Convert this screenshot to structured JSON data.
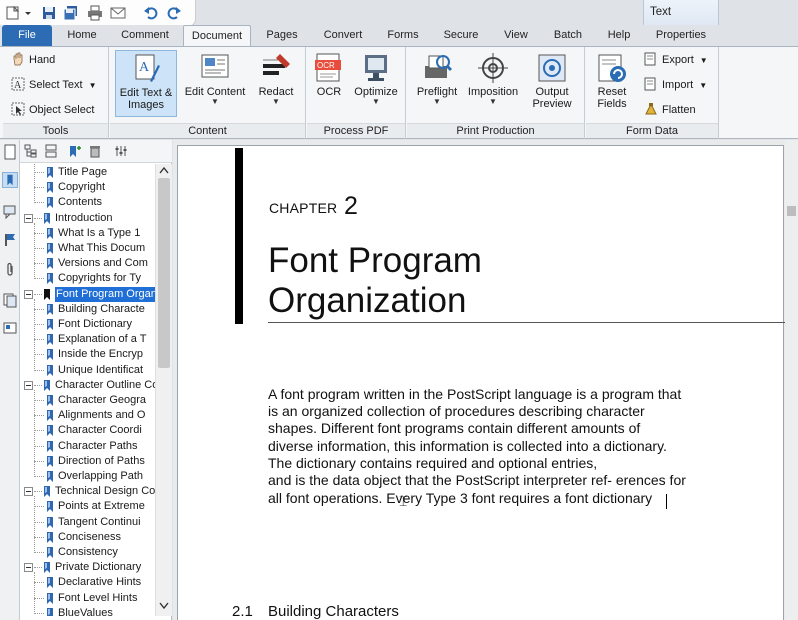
{
  "context_tab": {
    "label": "Text"
  },
  "tabs": [
    {
      "label": "File"
    },
    {
      "label": "Home"
    },
    {
      "label": "Comment"
    },
    {
      "label": "Document"
    },
    {
      "label": "Pages"
    },
    {
      "label": "Convert"
    },
    {
      "label": "Forms"
    },
    {
      "label": "Secure"
    },
    {
      "label": "View"
    },
    {
      "label": "Batch"
    },
    {
      "label": "Help"
    },
    {
      "label": "Properties"
    }
  ],
  "ribbon": {
    "tools": {
      "label": "Tools",
      "hand": "Hand",
      "select_text": "Select Text",
      "object_select": "Object Select"
    },
    "content": {
      "label": "Content",
      "edit_text_images": [
        "Edit Text &",
        "Images"
      ],
      "edit_content": "Edit Content",
      "redact": "Redact"
    },
    "process_pdf": {
      "label": "Process PDF",
      "ocr": "OCR",
      "optimize": "Optimize",
      "ocr_badge": "OCR"
    },
    "print_production": {
      "label": "Print Production",
      "preflight": "Preflight",
      "imposition": "Imposition",
      "output_preview": [
        "Output",
        "Preview"
      ]
    },
    "form_data": {
      "label": "Form Data",
      "reset_fields": [
        "Reset",
        "Fields"
      ],
      "export": "Export",
      "import": "Import",
      "flatten": "Flatten"
    }
  },
  "bookmarks": [
    {
      "label": "Title Page",
      "level": 1
    },
    {
      "label": "Copyright",
      "level": 1
    },
    {
      "label": "Contents",
      "level": 1
    },
    {
      "label": "Introduction",
      "level": 0,
      "expanded": true
    },
    {
      "label": "What Is a Type 1",
      "level": 1
    },
    {
      "label": "What This Docum",
      "level": 1
    },
    {
      "label": "Versions and Com",
      "level": 1
    },
    {
      "label": "Copyrights for Ty",
      "level": 1
    },
    {
      "label": "Font Program Organiz",
      "level": 0,
      "expanded": true,
      "selected": true
    },
    {
      "label": "Building Characte",
      "level": 1
    },
    {
      "label": "Font Dictionary",
      "level": 1
    },
    {
      "label": "Explanation of a T",
      "level": 1
    },
    {
      "label": "Inside the Encryp",
      "level": 1
    },
    {
      "label": "Unique Identificat",
      "level": 1
    },
    {
      "label": "Character Outline Co",
      "level": 0,
      "expanded": true
    },
    {
      "label": "Character Geogra",
      "level": 1
    },
    {
      "label": "Alignments and O",
      "level": 1
    },
    {
      "label": "Character Coordi",
      "level": 1
    },
    {
      "label": "Character Paths",
      "level": 1
    },
    {
      "label": "Direction of Paths",
      "level": 1
    },
    {
      "label": "Overlapping Path",
      "level": 1
    },
    {
      "label": "Technical Design Cons",
      "level": 0,
      "expanded": true
    },
    {
      "label": "Points at Extreme",
      "level": 1
    },
    {
      "label": "Tangent Continui",
      "level": 1
    },
    {
      "label": "Conciseness",
      "level": 1
    },
    {
      "label": "Consistency",
      "level": 1
    },
    {
      "label": "Private Dictionary",
      "level": 0,
      "expanded": true
    },
    {
      "label": "Declarative Hints",
      "level": 1
    },
    {
      "label": "Font Level Hints",
      "level": 1
    },
    {
      "label": "BlueValues",
      "level": 1
    }
  ],
  "document": {
    "chapter_label": "CHAPTER",
    "chapter_number": "2",
    "title_line1": "Font Program",
    "title_line2": "Organization",
    "body_lines": [
      "A font program written in the PostScript language is a program that",
      "is an organized collection of procedures describing character",
      "shapes. Different font programs contain different amounts of",
      "diverse information, this information is collected into a dictionary.",
      "The dictionary contains required and optional entries,",
      "and is the data object that the PostScript interpreter ref- erences for",
      "all font operations. Every Type 3 font requires a font dictionary"
    ],
    "section_number": "2.1",
    "section_title": "Building Characters"
  },
  "colors": {
    "accent": "#2b6cb4",
    "selection": "#1f6fd6",
    "pressed": "#cde3f7"
  }
}
